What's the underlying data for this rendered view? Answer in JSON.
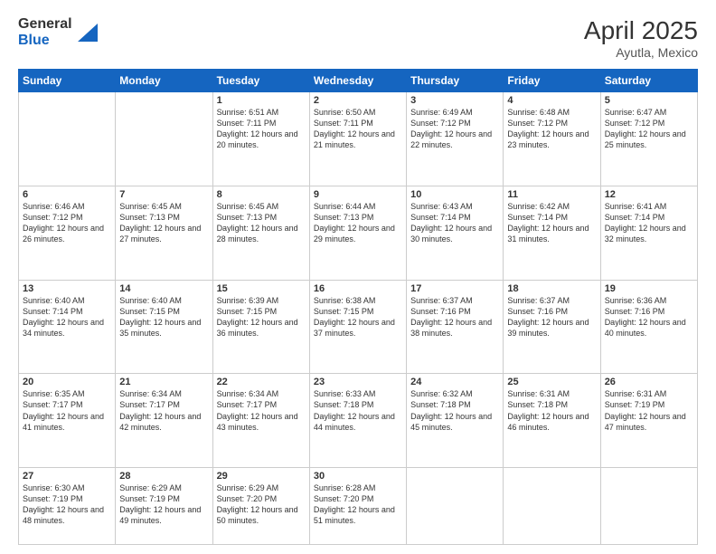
{
  "logo": {
    "general": "General",
    "blue": "Blue",
    "icon": "▶"
  },
  "title": {
    "month": "April 2025",
    "location": "Ayutla, Mexico"
  },
  "days_of_week": [
    "Sunday",
    "Monday",
    "Tuesday",
    "Wednesday",
    "Thursday",
    "Friday",
    "Saturday"
  ],
  "weeks": [
    [
      {
        "day": "",
        "info": ""
      },
      {
        "day": "",
        "info": ""
      },
      {
        "day": "1",
        "info": "Sunrise: 6:51 AM\nSunset: 7:11 PM\nDaylight: 12 hours and 20 minutes."
      },
      {
        "day": "2",
        "info": "Sunrise: 6:50 AM\nSunset: 7:11 PM\nDaylight: 12 hours and 21 minutes."
      },
      {
        "day": "3",
        "info": "Sunrise: 6:49 AM\nSunset: 7:12 PM\nDaylight: 12 hours and 22 minutes."
      },
      {
        "day": "4",
        "info": "Sunrise: 6:48 AM\nSunset: 7:12 PM\nDaylight: 12 hours and 23 minutes."
      },
      {
        "day": "5",
        "info": "Sunrise: 6:47 AM\nSunset: 7:12 PM\nDaylight: 12 hours and 25 minutes."
      }
    ],
    [
      {
        "day": "6",
        "info": "Sunrise: 6:46 AM\nSunset: 7:12 PM\nDaylight: 12 hours and 26 minutes."
      },
      {
        "day": "7",
        "info": "Sunrise: 6:45 AM\nSunset: 7:13 PM\nDaylight: 12 hours and 27 minutes."
      },
      {
        "day": "8",
        "info": "Sunrise: 6:45 AM\nSunset: 7:13 PM\nDaylight: 12 hours and 28 minutes."
      },
      {
        "day": "9",
        "info": "Sunrise: 6:44 AM\nSunset: 7:13 PM\nDaylight: 12 hours and 29 minutes."
      },
      {
        "day": "10",
        "info": "Sunrise: 6:43 AM\nSunset: 7:14 PM\nDaylight: 12 hours and 30 minutes."
      },
      {
        "day": "11",
        "info": "Sunrise: 6:42 AM\nSunset: 7:14 PM\nDaylight: 12 hours and 31 minutes."
      },
      {
        "day": "12",
        "info": "Sunrise: 6:41 AM\nSunset: 7:14 PM\nDaylight: 12 hours and 32 minutes."
      }
    ],
    [
      {
        "day": "13",
        "info": "Sunrise: 6:40 AM\nSunset: 7:14 PM\nDaylight: 12 hours and 34 minutes."
      },
      {
        "day": "14",
        "info": "Sunrise: 6:40 AM\nSunset: 7:15 PM\nDaylight: 12 hours and 35 minutes."
      },
      {
        "day": "15",
        "info": "Sunrise: 6:39 AM\nSunset: 7:15 PM\nDaylight: 12 hours and 36 minutes."
      },
      {
        "day": "16",
        "info": "Sunrise: 6:38 AM\nSunset: 7:15 PM\nDaylight: 12 hours and 37 minutes."
      },
      {
        "day": "17",
        "info": "Sunrise: 6:37 AM\nSunset: 7:16 PM\nDaylight: 12 hours and 38 minutes."
      },
      {
        "day": "18",
        "info": "Sunrise: 6:37 AM\nSunset: 7:16 PM\nDaylight: 12 hours and 39 minutes."
      },
      {
        "day": "19",
        "info": "Sunrise: 6:36 AM\nSunset: 7:16 PM\nDaylight: 12 hours and 40 minutes."
      }
    ],
    [
      {
        "day": "20",
        "info": "Sunrise: 6:35 AM\nSunset: 7:17 PM\nDaylight: 12 hours and 41 minutes."
      },
      {
        "day": "21",
        "info": "Sunrise: 6:34 AM\nSunset: 7:17 PM\nDaylight: 12 hours and 42 minutes."
      },
      {
        "day": "22",
        "info": "Sunrise: 6:34 AM\nSunset: 7:17 PM\nDaylight: 12 hours and 43 minutes."
      },
      {
        "day": "23",
        "info": "Sunrise: 6:33 AM\nSunset: 7:18 PM\nDaylight: 12 hours and 44 minutes."
      },
      {
        "day": "24",
        "info": "Sunrise: 6:32 AM\nSunset: 7:18 PM\nDaylight: 12 hours and 45 minutes."
      },
      {
        "day": "25",
        "info": "Sunrise: 6:31 AM\nSunset: 7:18 PM\nDaylight: 12 hours and 46 minutes."
      },
      {
        "day": "26",
        "info": "Sunrise: 6:31 AM\nSunset: 7:19 PM\nDaylight: 12 hours and 47 minutes."
      }
    ],
    [
      {
        "day": "27",
        "info": "Sunrise: 6:30 AM\nSunset: 7:19 PM\nDaylight: 12 hours and 48 minutes."
      },
      {
        "day": "28",
        "info": "Sunrise: 6:29 AM\nSunset: 7:19 PM\nDaylight: 12 hours and 49 minutes."
      },
      {
        "day": "29",
        "info": "Sunrise: 6:29 AM\nSunset: 7:20 PM\nDaylight: 12 hours and 50 minutes."
      },
      {
        "day": "30",
        "info": "Sunrise: 6:28 AM\nSunset: 7:20 PM\nDaylight: 12 hours and 51 minutes."
      },
      {
        "day": "",
        "info": ""
      },
      {
        "day": "",
        "info": ""
      },
      {
        "day": "",
        "info": ""
      }
    ]
  ]
}
